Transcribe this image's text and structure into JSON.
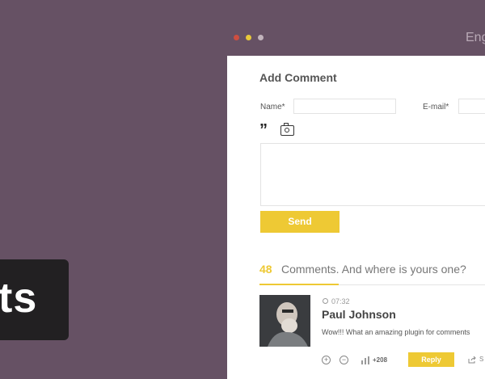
{
  "window": {
    "dots": [
      "#ce4e40",
      "#e8c93a",
      "#c2b4bc"
    ],
    "lang_label": "Eng"
  },
  "logo": {
    "text": "ts"
  },
  "form": {
    "title": "Add Comment",
    "name_label": "Name*",
    "email_label": "E-mail*",
    "name_value": "",
    "email_value": "",
    "comment_value": "",
    "quote_icon": "”",
    "send_label": "Send"
  },
  "comments": {
    "count": "48",
    "title": "Comments. And where is yours one?",
    "items": [
      {
        "time": "07:32",
        "author": "Paul Johnson",
        "text": "Wow!!! What an amazing plugin for comments",
        "votes": "+208",
        "reply_label": "Reply",
        "share_label": "S"
      }
    ]
  },
  "colors": {
    "accent": "#eec934",
    "background": "#665164"
  }
}
